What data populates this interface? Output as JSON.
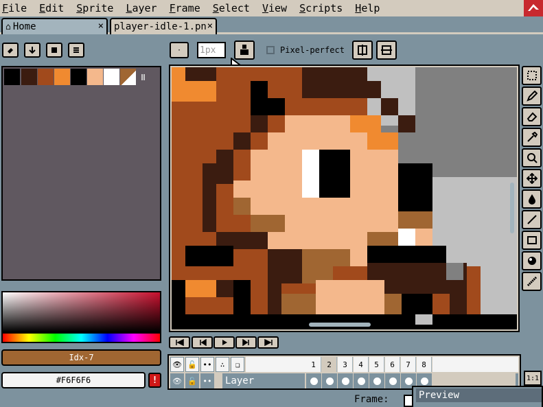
{
  "menu": [
    "File",
    "Edit",
    "Sprite",
    "Layer",
    "Frame",
    "Select",
    "View",
    "Scripts",
    "Help"
  ],
  "tabs": [
    {
      "label": "Home",
      "icon": "home-icon"
    },
    {
      "label": "player-idle-1.pn",
      "icon": ""
    }
  ],
  "close_glyph": "×",
  "left_tools": [
    "eraser-icon",
    "arrow-down-icon",
    "stop-icon",
    "menu-icon"
  ],
  "palette": {
    "colors": [
      "#000000",
      "#3b1c10",
      "#a14a1c",
      "#f08a30",
      "#000000",
      "#f4b88c",
      "#ffffff",
      "#a06632"
    ]
  },
  "brush": {
    "size": "1px",
    "pixel_perfect_label": "Pixel-perfect"
  },
  "color": {
    "index_label": "Idx-7",
    "hex_label": "#F6F6F6",
    "warn_glyph": "!"
  },
  "right_tools": [
    "marquee-icon",
    "pencil-icon",
    "eraser-icon",
    "eyedropper-icon",
    "zoom-icon",
    "move-icon",
    "bucket-icon",
    "line-icon",
    "rectangle-icon",
    "ellipse-icon",
    "blur-icon"
  ],
  "playback": [
    "first-frame-icon",
    "prev-frame-icon",
    "play-icon",
    "next-frame-icon",
    "last-frame-icon"
  ],
  "timeline": {
    "frames": [
      "1",
      "2",
      "3",
      "4",
      "5",
      "6",
      "7",
      "8"
    ],
    "layer_name": "Layer"
  },
  "frame_label": "Frame:",
  "preview_title": "Preview",
  "zoom_label": "1:1"
}
